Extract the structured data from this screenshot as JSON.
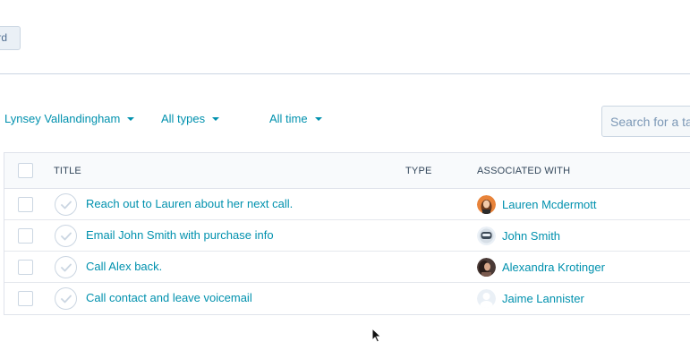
{
  "toolbar": {
    "top_button_label": "rd"
  },
  "filters": {
    "owner": "Lynsey Vallandingham",
    "types": "All types",
    "time": "All time",
    "search_placeholder": "Search for a task"
  },
  "table": {
    "headers": {
      "title": "TITLE",
      "type": "TYPE",
      "associated": "ASSOCIATED WITH"
    },
    "rows": [
      {
        "title": "Reach out to Lauren about her next call.",
        "type": "",
        "associated": "Lauren Mcdermott",
        "avatar": "photo-woman-avatar"
      },
      {
        "title": "Email John Smith with purchase info",
        "type": "",
        "associated": "John Smith",
        "avatar": "robot-avatar"
      },
      {
        "title": "Call Alex back.",
        "type": "",
        "associated": "Alexandra Krotinger",
        "avatar": "photo-person-avatar"
      },
      {
        "title": "Call contact and leave voicemail",
        "type": "",
        "associated": "Jaime Lannister",
        "avatar": "default-user-avatar"
      }
    ]
  },
  "colors": {
    "link": "#0091ae",
    "text": "#33475b",
    "border": "#cbd6e2"
  }
}
